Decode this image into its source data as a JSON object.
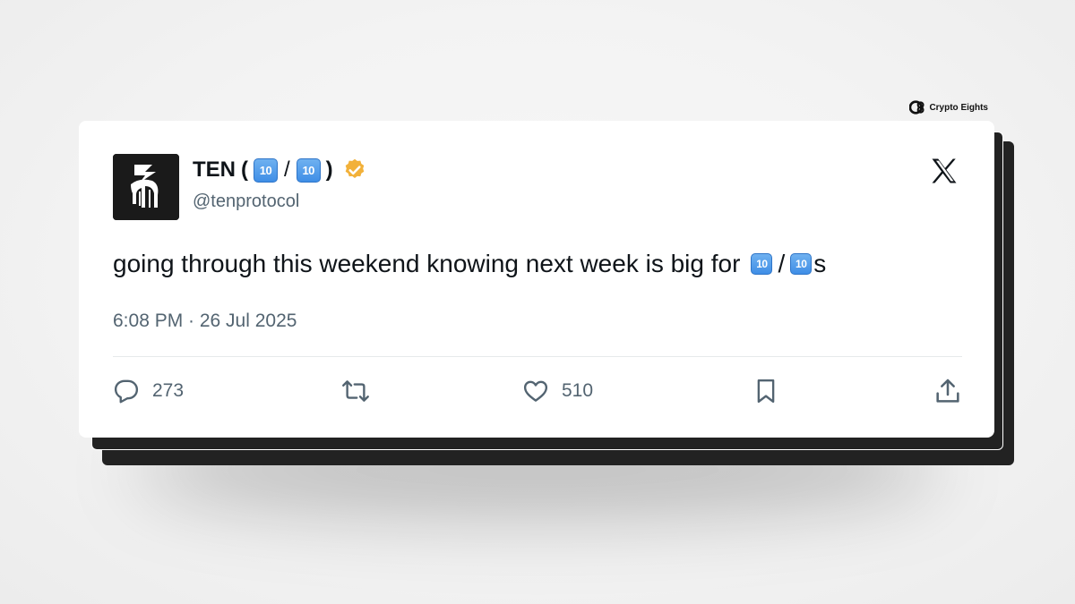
{
  "brand": {
    "label": "Crypto Eights",
    "icon": "crypto-eights-logo-icon"
  },
  "tweet": {
    "display_name": "TEN",
    "name_badge_text": "10",
    "slash": "/",
    "handle": "@tenprotocol",
    "verified": true,
    "verified_color": "#F2B13A",
    "text_before": "going through this weekend knowing next week is big for",
    "text_after": "s",
    "timestamp": "6:08 PM · 26 Jul 2025",
    "platform_icon": "x-logo-icon"
  },
  "actions": {
    "reply": {
      "icon": "reply-icon",
      "count": "273"
    },
    "retweet": {
      "icon": "retweet-icon"
    },
    "like": {
      "icon": "heart-icon",
      "count": "510"
    },
    "bookmark": {
      "icon": "bookmark-icon"
    },
    "share": {
      "icon": "share-icon"
    }
  },
  "colors": {
    "text_primary": "#0F1419",
    "text_secondary": "#536471",
    "badge_blue": "#4A96E8",
    "stack_dark": "#222222"
  }
}
